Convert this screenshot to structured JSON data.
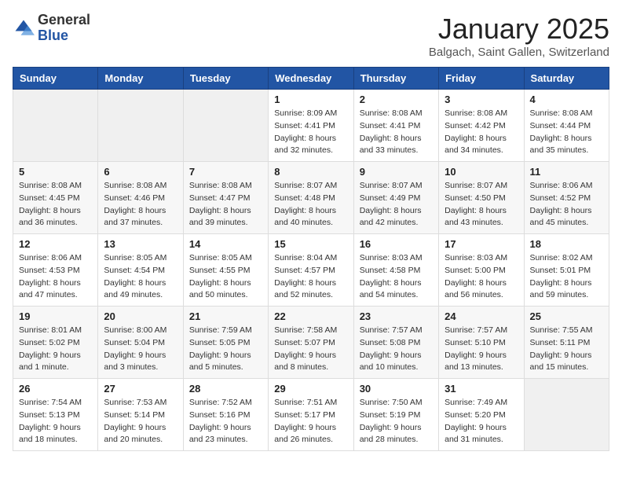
{
  "header": {
    "logo_general": "General",
    "logo_blue": "Blue",
    "title": "January 2025",
    "location": "Balgach, Saint Gallen, Switzerland"
  },
  "days_of_week": [
    "Sunday",
    "Monday",
    "Tuesday",
    "Wednesday",
    "Thursday",
    "Friday",
    "Saturday"
  ],
  "weeks": [
    [
      {
        "day": "",
        "info": ""
      },
      {
        "day": "",
        "info": ""
      },
      {
        "day": "",
        "info": ""
      },
      {
        "day": "1",
        "info": "Sunrise: 8:09 AM\nSunset: 4:41 PM\nDaylight: 8 hours and 32 minutes."
      },
      {
        "day": "2",
        "info": "Sunrise: 8:08 AM\nSunset: 4:41 PM\nDaylight: 8 hours and 33 minutes."
      },
      {
        "day": "3",
        "info": "Sunrise: 8:08 AM\nSunset: 4:42 PM\nDaylight: 8 hours and 34 minutes."
      },
      {
        "day": "4",
        "info": "Sunrise: 8:08 AM\nSunset: 4:44 PM\nDaylight: 8 hours and 35 minutes."
      }
    ],
    [
      {
        "day": "5",
        "info": "Sunrise: 8:08 AM\nSunset: 4:45 PM\nDaylight: 8 hours and 36 minutes."
      },
      {
        "day": "6",
        "info": "Sunrise: 8:08 AM\nSunset: 4:46 PM\nDaylight: 8 hours and 37 minutes."
      },
      {
        "day": "7",
        "info": "Sunrise: 8:08 AM\nSunset: 4:47 PM\nDaylight: 8 hours and 39 minutes."
      },
      {
        "day": "8",
        "info": "Sunrise: 8:07 AM\nSunset: 4:48 PM\nDaylight: 8 hours and 40 minutes."
      },
      {
        "day": "9",
        "info": "Sunrise: 8:07 AM\nSunset: 4:49 PM\nDaylight: 8 hours and 42 minutes."
      },
      {
        "day": "10",
        "info": "Sunrise: 8:07 AM\nSunset: 4:50 PM\nDaylight: 8 hours and 43 minutes."
      },
      {
        "day": "11",
        "info": "Sunrise: 8:06 AM\nSunset: 4:52 PM\nDaylight: 8 hours and 45 minutes."
      }
    ],
    [
      {
        "day": "12",
        "info": "Sunrise: 8:06 AM\nSunset: 4:53 PM\nDaylight: 8 hours and 47 minutes."
      },
      {
        "day": "13",
        "info": "Sunrise: 8:05 AM\nSunset: 4:54 PM\nDaylight: 8 hours and 49 minutes."
      },
      {
        "day": "14",
        "info": "Sunrise: 8:05 AM\nSunset: 4:55 PM\nDaylight: 8 hours and 50 minutes."
      },
      {
        "day": "15",
        "info": "Sunrise: 8:04 AM\nSunset: 4:57 PM\nDaylight: 8 hours and 52 minutes."
      },
      {
        "day": "16",
        "info": "Sunrise: 8:03 AM\nSunset: 4:58 PM\nDaylight: 8 hours and 54 minutes."
      },
      {
        "day": "17",
        "info": "Sunrise: 8:03 AM\nSunset: 5:00 PM\nDaylight: 8 hours and 56 minutes."
      },
      {
        "day": "18",
        "info": "Sunrise: 8:02 AM\nSunset: 5:01 PM\nDaylight: 8 hours and 59 minutes."
      }
    ],
    [
      {
        "day": "19",
        "info": "Sunrise: 8:01 AM\nSunset: 5:02 PM\nDaylight: 9 hours and 1 minute."
      },
      {
        "day": "20",
        "info": "Sunrise: 8:00 AM\nSunset: 5:04 PM\nDaylight: 9 hours and 3 minutes."
      },
      {
        "day": "21",
        "info": "Sunrise: 7:59 AM\nSunset: 5:05 PM\nDaylight: 9 hours and 5 minutes."
      },
      {
        "day": "22",
        "info": "Sunrise: 7:58 AM\nSunset: 5:07 PM\nDaylight: 9 hours and 8 minutes."
      },
      {
        "day": "23",
        "info": "Sunrise: 7:57 AM\nSunset: 5:08 PM\nDaylight: 9 hours and 10 minutes."
      },
      {
        "day": "24",
        "info": "Sunrise: 7:57 AM\nSunset: 5:10 PM\nDaylight: 9 hours and 13 minutes."
      },
      {
        "day": "25",
        "info": "Sunrise: 7:55 AM\nSunset: 5:11 PM\nDaylight: 9 hours and 15 minutes."
      }
    ],
    [
      {
        "day": "26",
        "info": "Sunrise: 7:54 AM\nSunset: 5:13 PM\nDaylight: 9 hours and 18 minutes."
      },
      {
        "day": "27",
        "info": "Sunrise: 7:53 AM\nSunset: 5:14 PM\nDaylight: 9 hours and 20 minutes."
      },
      {
        "day": "28",
        "info": "Sunrise: 7:52 AM\nSunset: 5:16 PM\nDaylight: 9 hours and 23 minutes."
      },
      {
        "day": "29",
        "info": "Sunrise: 7:51 AM\nSunset: 5:17 PM\nDaylight: 9 hours and 26 minutes."
      },
      {
        "day": "30",
        "info": "Sunrise: 7:50 AM\nSunset: 5:19 PM\nDaylight: 9 hours and 28 minutes."
      },
      {
        "day": "31",
        "info": "Sunrise: 7:49 AM\nSunset: 5:20 PM\nDaylight: 9 hours and 31 minutes."
      },
      {
        "day": "",
        "info": ""
      }
    ]
  ]
}
